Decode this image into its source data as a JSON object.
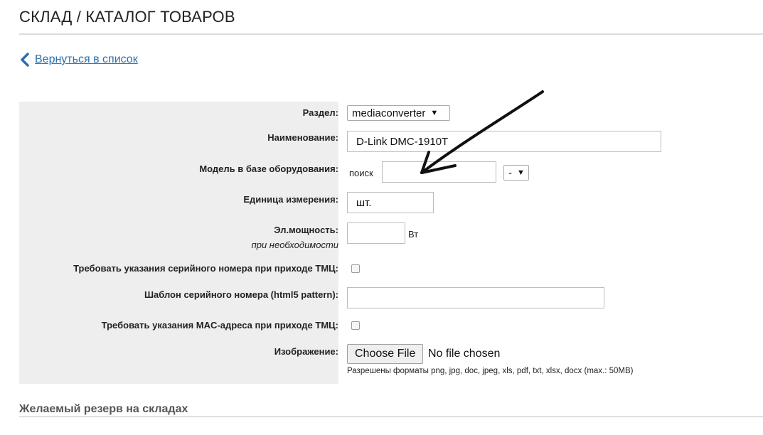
{
  "header": {
    "title": "СКЛАД / КАТАЛОГ ТОВАРОВ"
  },
  "nav": {
    "back_label": "Вернуться в список"
  },
  "form": {
    "section_label": "Раздел:",
    "section_value": "mediaconverter",
    "name_label": "Наименование:",
    "name_value": "D-Link DMC-1910T",
    "model_label": "Модель в базе оборудования:",
    "model_search_label": "поиск",
    "model_search_value": "",
    "model_select_value": "-",
    "unit_label": "Единица измерения:",
    "unit_value": "шт.",
    "power_label": "Эл.мощность:",
    "power_sublabel": "при необходимости",
    "power_value": "",
    "power_unit": "Вт",
    "serial_required_label": "Требовать указания серийного номера при приходе ТМЦ:",
    "serial_pattern_label": "Шаблон серийного номера (html5 pattern):",
    "serial_pattern_value": "",
    "mac_required_label": "Требовать указания MAC-адреса при приходе ТМЦ:",
    "image_label": "Изображение:",
    "file_button_label": "Choose File",
    "file_status": "No file chosen",
    "file_hint": "Разрешены форматы png, jpg, doc, jpeg, xls, pdf, txt, xlsx, docx (max.: 50MB)"
  },
  "reserve": {
    "title": "Желаемый резерв на складах"
  },
  "colors": {
    "link": "#2a70b0",
    "label_bg": "#eeeeee",
    "arrow": "#111111"
  }
}
